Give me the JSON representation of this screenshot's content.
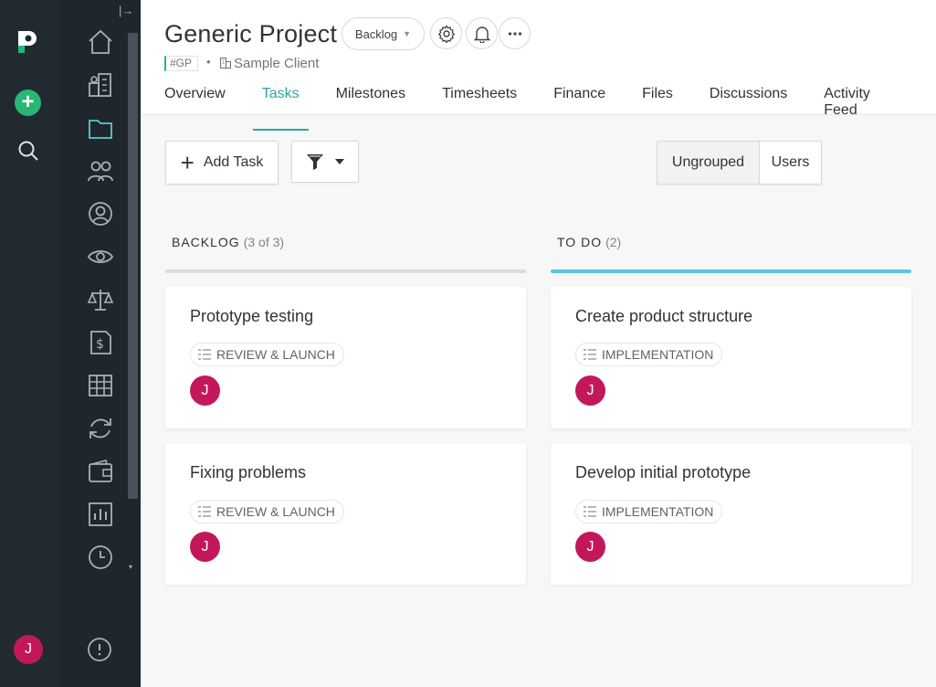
{
  "rail": {
    "logo_letter": "p",
    "add_label": "+",
    "user_initial": "J",
    "accent": "#27b774",
    "avatar_color": "#c2185b"
  },
  "nav": {
    "collapse_glyph": "|→",
    "items": [
      {
        "icon": "home-icon"
      },
      {
        "icon": "building-icon"
      },
      {
        "icon": "folder-icon",
        "active": true
      },
      {
        "icon": "people-icon"
      },
      {
        "icon": "user-circle-icon"
      },
      {
        "icon": "eye-icon"
      },
      {
        "icon": "scales-icon"
      },
      {
        "icon": "invoice-icon"
      },
      {
        "icon": "table-icon"
      },
      {
        "icon": "refresh-icon"
      },
      {
        "icon": "wallet-icon"
      },
      {
        "icon": "report-icon"
      },
      {
        "icon": "clock-icon"
      }
    ],
    "scroll_arrow": "▾"
  },
  "header": {
    "title": "Generic Project",
    "status": "Backlog",
    "code": "#GP",
    "separator": "•",
    "client": "Sample Client",
    "tabs": [
      {
        "label": "Overview"
      },
      {
        "label": "Tasks",
        "active": true
      },
      {
        "label": "Milestones"
      },
      {
        "label": "Timesheets"
      },
      {
        "label": "Finance"
      },
      {
        "label": "Files"
      },
      {
        "label": "Discussions"
      },
      {
        "label": "Activity Feed"
      }
    ]
  },
  "toolbar": {
    "add_task_label": "Add Task",
    "group_options": [
      "Ungrouped",
      "Users"
    ],
    "group_selected": "Ungrouped"
  },
  "columns": [
    {
      "name": "BACKLOG",
      "count": "(3 of 3)",
      "bar_color": "#dcdcdc",
      "cards": [
        {
          "title": "Prototype testing",
          "tag": "REVIEW & LAUNCH",
          "assignee": "J"
        },
        {
          "title": "Fixing problems",
          "tag": "REVIEW & LAUNCH",
          "assignee": "J"
        }
      ]
    },
    {
      "name": "TO DO",
      "count": "(2)",
      "bar_color": "#5bc8d8",
      "cards": [
        {
          "title": "Create product structure",
          "tag": "IMPLEMENTATION",
          "assignee": "J"
        },
        {
          "title": "Develop initial prototype",
          "tag": "IMPLEMENTATION",
          "assignee": "J"
        }
      ]
    }
  ]
}
